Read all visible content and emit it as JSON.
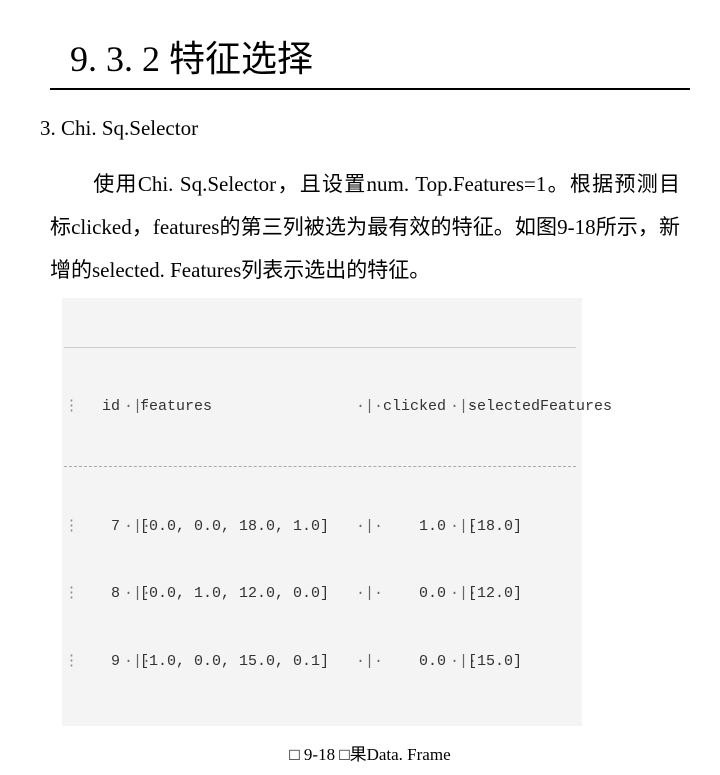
{
  "heading": "9. 3. 2  特征选择",
  "subhead": "3. Chi. Sq.Selector",
  "body_html": "使用Chi. Sq.Selector，且设置num. Top.Features=1。根据预测目标clicked，features的第三列被选为最有效的特征。如图9-18所示，新增的selected. Features列表示选出的特征。",
  "table": {
    "headers": {
      "id": "id",
      "features": "features",
      "clicked": "clicked",
      "selected": "selectedFeatures"
    },
    "rows": [
      {
        "id": "7",
        "features": "[0.0, 0.0, 18.0, 1.0]",
        "clicked": "1.0",
        "selected": "[18.0]"
      },
      {
        "id": "8",
        "features": "[0.0, 1.0, 12.0, 0.0]",
        "clicked": "0.0",
        "selected": "[12.0]"
      },
      {
        "id": "9",
        "features": "[1.0, 0.0, 15.0, 0.1]",
        "clicked": "0.0",
        "selected": "[15.0]"
      }
    ]
  },
  "caption_prefix": "□ 9‑18 □果Data. Frame"
}
